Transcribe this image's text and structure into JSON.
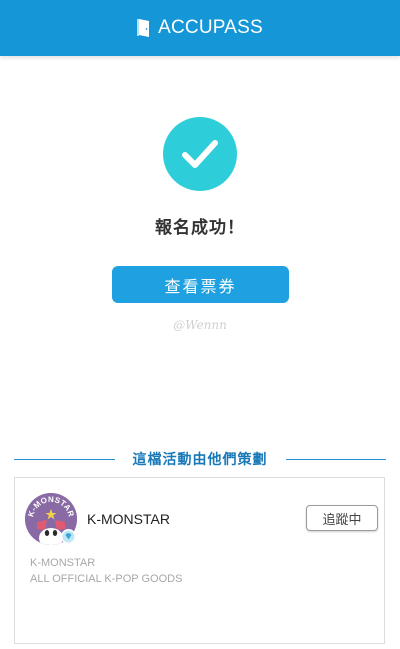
{
  "header": {
    "brand_name": "ACCUPASS",
    "logo_icon": "door-logo-icon",
    "background_color": "#1496d7"
  },
  "status": {
    "icon": "check-circle-icon",
    "icon_color": "#2ecdda",
    "message": "報名成功！"
  },
  "actions": {
    "view_tickets_label": "查看票券",
    "button_color": "#1ea0e1"
  },
  "watermark": {
    "text": "@Wennn"
  },
  "organizer_section": {
    "title": "這檔活動由他們策劃",
    "accent_color": "#1e8fcf",
    "organizer": {
      "avatar_text": "K-MONSTAR",
      "name": "K-MONSTAR",
      "follow_label": "追蹤中",
      "description_lines": [
        "K-MONSTAR",
        "ALL OFFICIAL K-POP GOODS"
      ]
    }
  }
}
